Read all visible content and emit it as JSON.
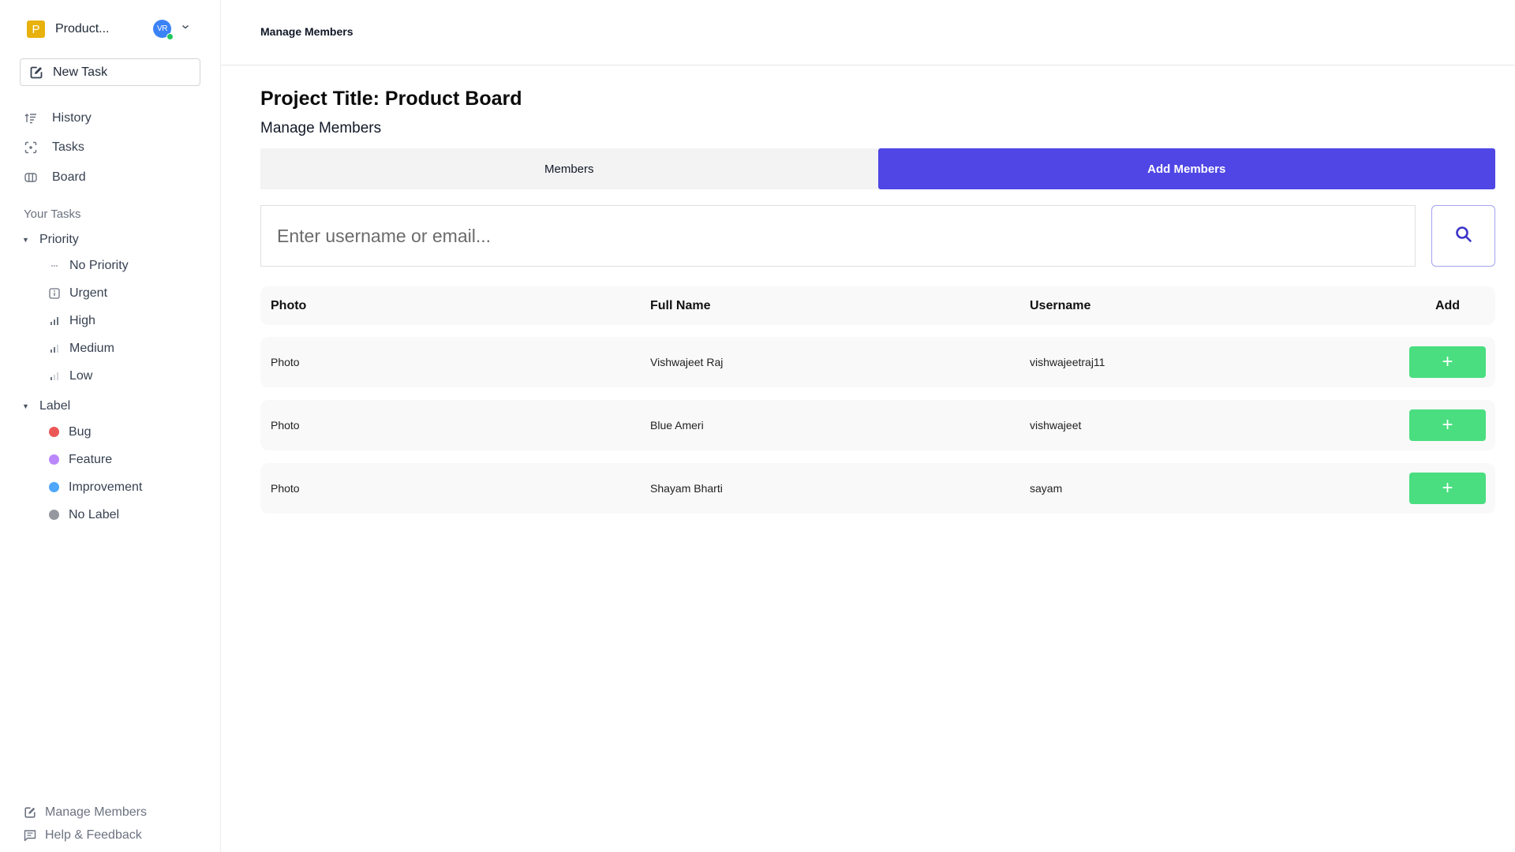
{
  "sidebar": {
    "workspace": {
      "logo_letter": "P",
      "name": "Product...",
      "logo_color": "#E8B10B"
    },
    "user": {
      "initials": "VR",
      "status": "online",
      "avatar_color": "#3B82F6",
      "status_color": "#22C55E"
    },
    "new_task_label": "New Task",
    "nav": [
      {
        "label": "History",
        "icon": "history-sort-icon"
      },
      {
        "label": "Tasks",
        "icon": "focus-icon"
      },
      {
        "label": "Board",
        "icon": "columns-icon"
      }
    ],
    "section_title": "Your Tasks",
    "priority_group": {
      "label": "Priority",
      "items": [
        {
          "label": "No Priority",
          "icon": "no-priority-icon"
        },
        {
          "label": "Urgent",
          "icon": "urgent-icon"
        },
        {
          "label": "High",
          "icon": "signal-high-icon"
        },
        {
          "label": "Medium",
          "icon": "signal-medium-icon"
        },
        {
          "label": "Low",
          "icon": "signal-low-icon"
        }
      ]
    },
    "label_group": {
      "label": "Label",
      "items": [
        {
          "label": "Bug",
          "color": "#EB5757"
        },
        {
          "label": "Feature",
          "color": "#BB87FC"
        },
        {
          "label": "Improvement",
          "color": "#4EA7FC"
        },
        {
          "label": "No Label",
          "color": "#95999F"
        }
      ]
    },
    "footer": [
      {
        "label": "Manage Members",
        "icon": "edit-icon"
      },
      {
        "label": "Help & Feedback",
        "icon": "message-icon"
      }
    ]
  },
  "header": {
    "breadcrumb": "Manage Members"
  },
  "main": {
    "title": "Project Title: Product Board",
    "subtitle": "Manage Members",
    "tabs": [
      {
        "label": "Members",
        "active": false
      },
      {
        "label": "Add Members",
        "active": true
      }
    ],
    "accent_color": "#4F46E5",
    "search": {
      "value": "",
      "placeholder": "Enter username or email..."
    },
    "table": {
      "columns": [
        "Photo",
        "Full Name",
        "Username",
        "Add"
      ],
      "rows": [
        {
          "photo": "Photo",
          "full_name": "Vishwajeet Raj",
          "username": "vishwajeetraj11",
          "add": "+"
        },
        {
          "photo": "Photo",
          "full_name": "Blue Ameri",
          "username": "vishwajeet",
          "add": "+"
        },
        {
          "photo": "Photo",
          "full_name": "Shayam Bharti",
          "username": "sayam",
          "add": "+"
        }
      ],
      "add_button_color": "#4ADE80"
    }
  }
}
